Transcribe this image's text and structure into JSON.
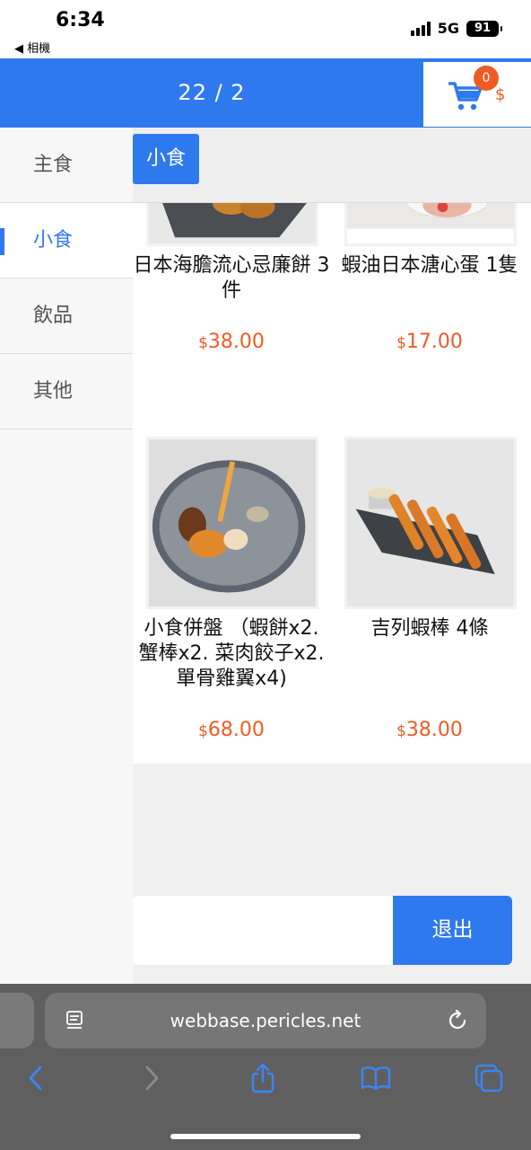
{
  "status_bar": {
    "time": "6:34",
    "back_label": "◀ 相機",
    "network": "5G",
    "battery": "91"
  },
  "header": {
    "page_counter": "22 / 2",
    "cart_count": "0",
    "cart_total": "$",
    "cart_icon": "shopping-cart-icon"
  },
  "sidebar": {
    "items": [
      {
        "label": "主食",
        "active": false
      },
      {
        "label": "小食",
        "active": true
      },
      {
        "label": "飲品",
        "active": false
      },
      {
        "label": "其他",
        "active": false
      }
    ]
  },
  "section": {
    "title": "小食"
  },
  "products": [
    {
      "name": "日本海膽流心忌廉餅 3件",
      "currency": "$",
      "price": "38.00"
    },
    {
      "name": "蝦油日本溏心蛋 1隻",
      "currency": "$",
      "price": "17.00"
    },
    {
      "name": "小食併盤 （蝦餅x2. 蟹棒x2. 菜肉餃子x2. 單骨雞翼x4)",
      "currency": "$",
      "price": "68.00"
    },
    {
      "name": "吉列蝦棒 4條",
      "currency": "$",
      "price": "38.00"
    }
  ],
  "action_bar": {
    "exit_label": "退出"
  },
  "browser": {
    "url": "webbase.pericles.net"
  },
  "colors": {
    "accent": "#2f79ee",
    "price": "#f05b23",
    "badge": "#f05b23"
  }
}
